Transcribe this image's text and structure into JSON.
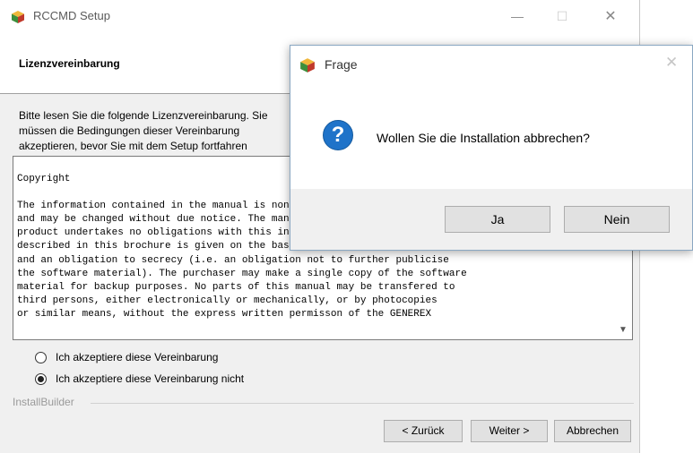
{
  "window": {
    "title": "RCCMD Setup",
    "minimize": "—",
    "maximize": "☐",
    "close": "✕",
    "icon": "box-icon"
  },
  "header": {
    "title": "Lizenzvereinbarung"
  },
  "instructions": "Bitte lesen Sie die folgende Lizenzvereinbarung. Sie müssen die Bedingungen dieser Vereinbarung\nakzeptieren, bevor Sie mit dem Setup fortfahren",
  "license_text": "Copyright\n\nThe information contained in the manual is non-conditional\nand may be changed without due notice. The manufacturer of the\nproduct undertakes no obligations with this information. The software\ndescribed in this brochure is given on the basis of a license contract\nand an obligation to secrecy (i.e. an obligation not to further publicise\nthe software material). The purchaser may make a single copy of the software\nmaterial for backup purposes. No parts of this manual may be transfered to\nthird persons, either electronically or mechanically, or by photocopies\nor similar means, without the express written permisson of the GENEREX",
  "scroll_arrow": "▼",
  "radio": {
    "accept": {
      "label": "Ich akzeptiere diese Vereinbarung",
      "checked": false
    },
    "decline": {
      "label": "Ich akzeptiere diese Vereinbarung nicht",
      "checked": true
    }
  },
  "footer_brand": "InstallBuilder",
  "buttons": {
    "back": "< Zurück",
    "next": "Weiter >",
    "cancel": "Abbrechen"
  },
  "dialog": {
    "title": "Frage",
    "close": "✕",
    "icon": "question-icon",
    "icon_glyph": "?",
    "message": "Wollen Sie die Installation abbrechen?",
    "yes": "Ja",
    "no": "Nein"
  }
}
